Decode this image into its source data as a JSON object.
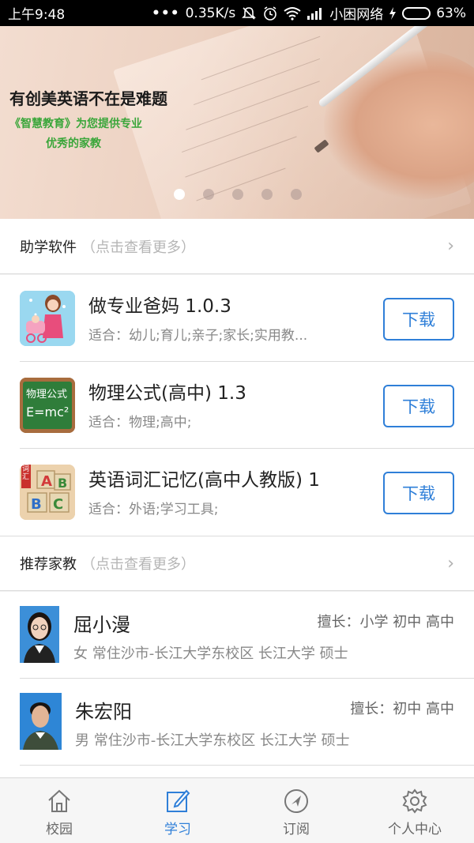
{
  "status_bar": {
    "time": "上午9:48",
    "dots": "•••",
    "net_speed": "0.35K/s",
    "carrier": "小困网络",
    "battery_pct": "63%",
    "battery_level": 0.63
  },
  "banner": {
    "title": "有创美英语不在是难题",
    "subtitle_line1": "《智慧教育》为您提供专业",
    "subtitle_line2": "优秀的家教",
    "page_count": 5,
    "active_page": 0
  },
  "software_section": {
    "title": "助学软件",
    "hint": "（点击查看更多）",
    "chevron": "›"
  },
  "apps": [
    {
      "name": "做专业爸妈 1.0.3",
      "tags": "适合：幼儿;育儿;亲子;家长;实用教...",
      "button": "下载",
      "icon": "mother-baby-icon"
    },
    {
      "name": "物理公式(高中) 1.3",
      "tags": "适合：物理;高中;",
      "button": "下载",
      "icon": "physics-formula-icon",
      "icon_text_top": "物理公式",
      "icon_text_bottom": "E=mc²"
    },
    {
      "name": "英语词汇记忆(高中人教版) 1",
      "tags": "适合：外语;学习工具;",
      "button": "下载",
      "icon": "abc-blocks-icon",
      "icon_ribbon": "词汇"
    }
  ],
  "tutor_section": {
    "title": "推荐家教",
    "hint": "（点击查看更多）",
    "chevron": "›"
  },
  "tutors": [
    {
      "name": "屈小漫",
      "specialty": "擅长：小学 初中 高中",
      "info": "女 常住沙市-长江大学东校区 长江大学 硕士"
    },
    {
      "name": "朱宏阳",
      "specialty": "擅长：初中 高中",
      "info": "男 常住沙市-长江大学东校区 长江大学 硕士"
    }
  ],
  "tabs": [
    {
      "label": "校园",
      "icon": "house-icon",
      "active": false
    },
    {
      "label": "学习",
      "icon": "edit-icon",
      "active": true
    },
    {
      "label": "订阅",
      "icon": "compass-icon",
      "active": false
    },
    {
      "label": "个人中心",
      "icon": "gear-icon",
      "active": false
    }
  ],
  "colors": {
    "accent": "#2f7fd8",
    "banner_sub": "#3aa63a"
  }
}
